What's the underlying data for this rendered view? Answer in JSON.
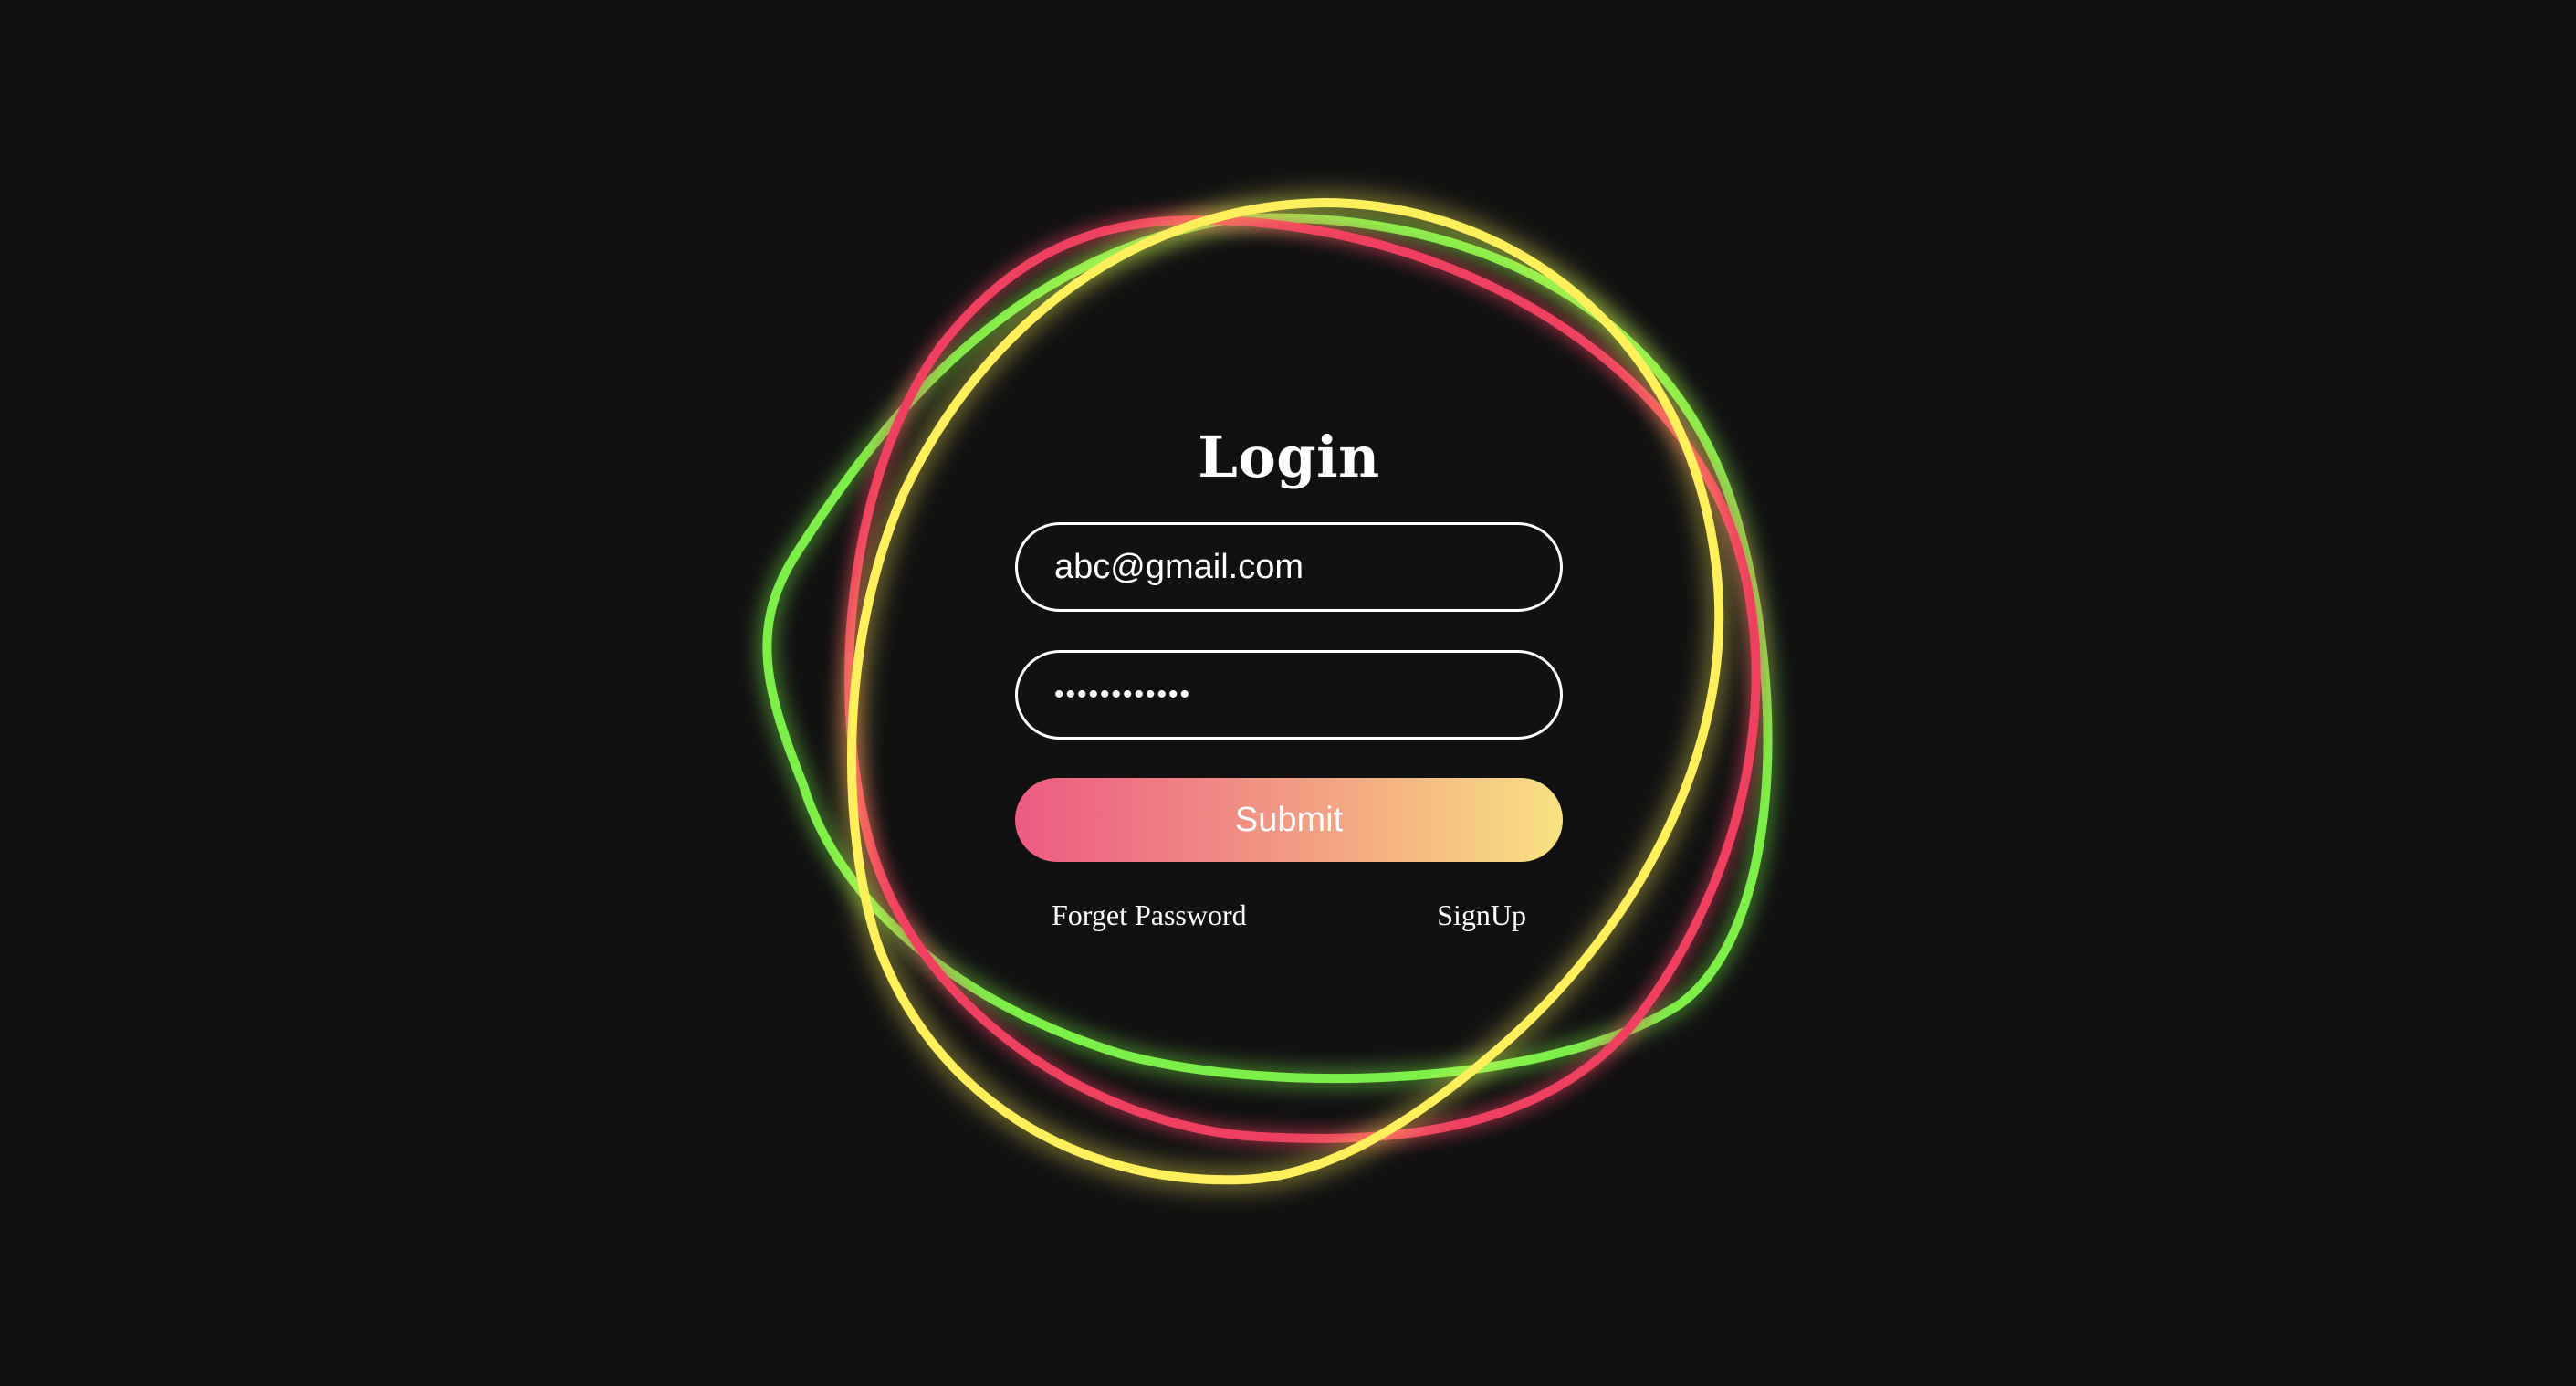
{
  "page": {
    "background": "#111111"
  },
  "rings": {
    "colors": [
      "#7cf04a",
      "#ef3f5e",
      "#ffef5a"
    ]
  },
  "login": {
    "title": "Login",
    "email_value": "abc@gmail.com",
    "password_value": "••••••••••••",
    "submit_label": "Submit",
    "forget_password_label": "Forget Password",
    "signup_label": "SignUp",
    "submit_gradient": [
      "#ee5a82",
      "#f2a083",
      "#f8e281"
    ]
  }
}
